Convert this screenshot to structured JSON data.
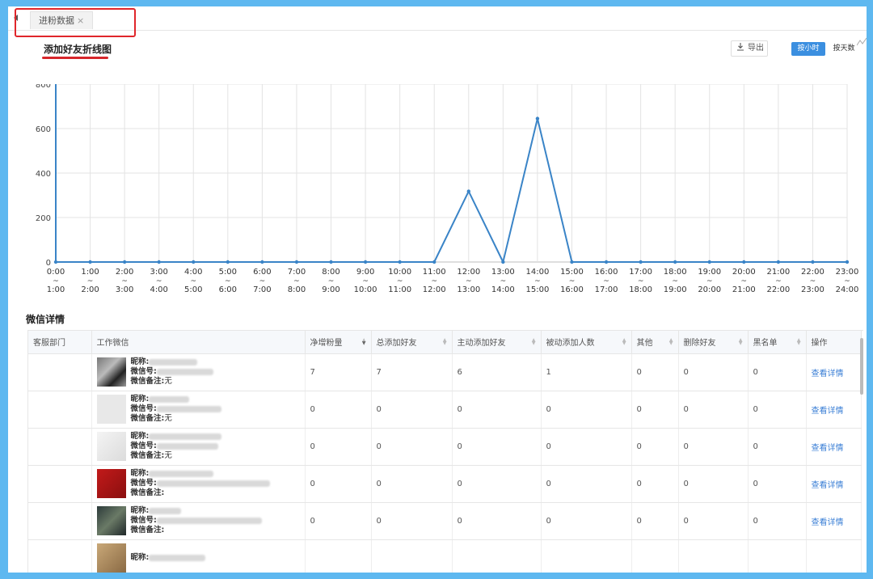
{
  "tab": {
    "label": "进粉数据",
    "close": "×"
  },
  "chart_card": {
    "title": "添加好友折线图",
    "export_label": "导出",
    "mode_options": [
      "按小时",
      "按天数"
    ],
    "selected_mode": "按小时"
  },
  "chart_data": {
    "type": "line",
    "title": "添加好友折线图",
    "xlabel": "",
    "ylabel": "",
    "categories": [
      "0:00~1:00",
      "1:00~2:00",
      "2:00~3:00",
      "3:00~4:00",
      "4:00~5:00",
      "5:00~6:00",
      "6:00~7:00",
      "7:00~8:00",
      "8:00~9:00",
      "9:00~10:00",
      "10:00~11:00",
      "11:00~12:00",
      "12:00~13:00",
      "13:00~14:00",
      "14:00~15:00",
      "15:00~16:00",
      "16:00~17:00",
      "17:00~18:00",
      "18:00~19:00",
      "19:00~20:00",
      "20:00~21:00",
      "21:00~22:00",
      "22:00~23:00",
      "23:00~24:00"
    ],
    "x_labels_top": [
      "0:00",
      "1:00",
      "2:00",
      "3:00",
      "4:00",
      "5:00",
      "6:00",
      "7:00",
      "8:00",
      "9:00",
      "10:00",
      "11:00",
      "12:00",
      "13:00",
      "14:00",
      "15:00",
      "16:00",
      "17:00",
      "18:00",
      "19:00",
      "20:00",
      "21:00",
      "22:00",
      "23:00"
    ],
    "x_labels_bottom": [
      "1:00",
      "2:00",
      "3:00",
      "4:00",
      "5:00",
      "6:00",
      "7:00",
      "8:00",
      "9:00",
      "10:00",
      "11:00",
      "12:00",
      "13:00",
      "14:00",
      "15:00",
      "16:00",
      "17:00",
      "18:00",
      "19:00",
      "20:00",
      "21:00",
      "22:00",
      "23:00",
      "24:00"
    ],
    "x_separator": "~",
    "values": [
      0,
      0,
      0,
      0,
      0,
      0,
      0,
      0,
      0,
      0,
      0,
      0,
      318,
      0,
      645,
      0,
      0,
      0,
      0,
      0,
      0,
      0,
      0,
      0
    ],
    "ylim": [
      0,
      800
    ],
    "yticks": [
      0,
      200,
      400,
      600,
      800
    ],
    "grid": true,
    "line_color": "#3a84c7"
  },
  "details": {
    "title": "微信详情",
    "columns": [
      "客服部门",
      "工作微信",
      "净增粉量",
      "总添加好友",
      "主动添加好友",
      "被动添加人数",
      "其他",
      "删除好友",
      "黑名单",
      "操作"
    ],
    "labels": {
      "nickname": "昵称:",
      "wechat_id": "微信号:",
      "remark": "微信备注:"
    },
    "action_label": "查看详情",
    "rows": [
      {
        "dept": "",
        "net": "7",
        "total": "7",
        "active": "6",
        "passive": "1",
        "other": "0",
        "deleted": "0",
        "blacklist": "0",
        "remark_tail": "无"
      },
      {
        "dept": "",
        "net": "0",
        "total": "0",
        "active": "0",
        "passive": "0",
        "other": "0",
        "deleted": "0",
        "blacklist": "0",
        "remark_tail": "无"
      },
      {
        "dept": "",
        "net": "0",
        "total": "0",
        "active": "0",
        "passive": "0",
        "other": "0",
        "deleted": "0",
        "blacklist": "0",
        "remark_tail": "无"
      },
      {
        "dept": "",
        "net": "0",
        "total": "0",
        "active": "0",
        "passive": "0",
        "other": "0",
        "deleted": "0",
        "blacklist": "0",
        "remark_tail": ""
      },
      {
        "dept": "",
        "net": "0",
        "total": "0",
        "active": "0",
        "passive": "0",
        "other": "0",
        "deleted": "0",
        "blacklist": "0",
        "remark_tail": ""
      }
    ],
    "partial_row_label": "昵称:"
  },
  "colors": {
    "accent": "#3b8fe0",
    "highlight": "#e0262b",
    "link": "#3b7fd6"
  }
}
